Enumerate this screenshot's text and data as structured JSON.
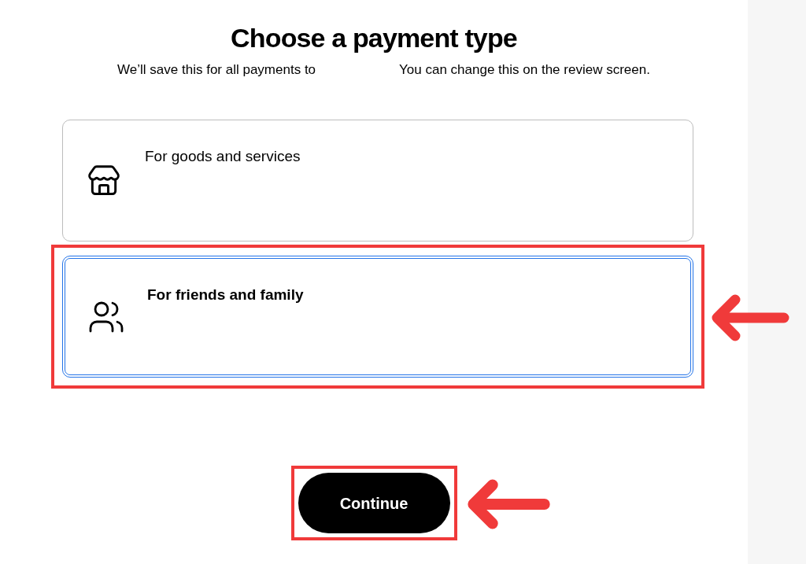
{
  "title": "Choose a payment type",
  "subtitle": [
    "We’ll save this for all payments to",
    "You can change this on the review screen."
  ],
  "options": [
    {
      "kind": "store",
      "label": "For goods and services",
      "selected": false,
      "highlighted": false
    },
    {
      "kind": "people",
      "label": "For friends and family",
      "selected": true,
      "highlighted": true
    }
  ],
  "continue_button": {
    "label": "Continue",
    "highlighted": true
  }
}
